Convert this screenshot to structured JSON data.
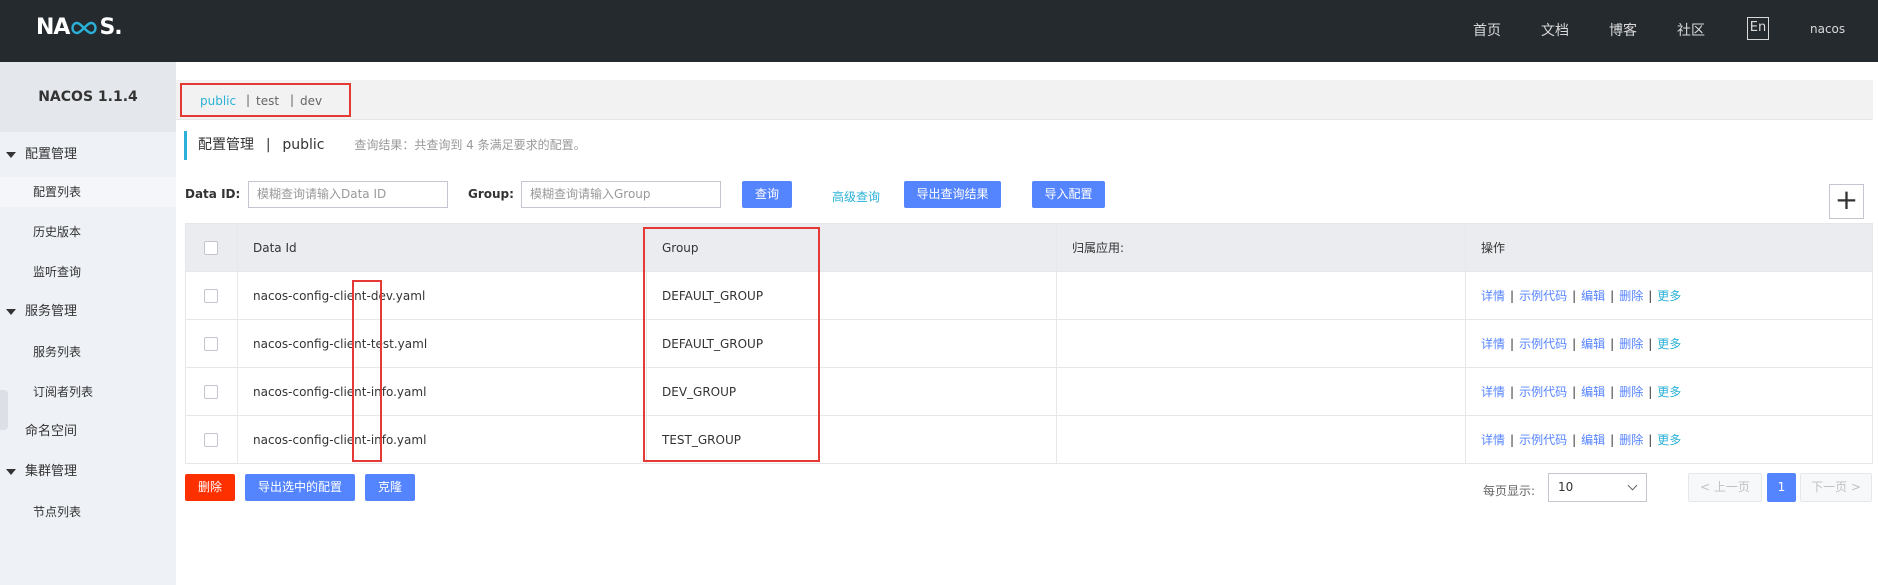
{
  "app": {
    "logo": "NACOS.",
    "version": "NACOS 1.1.4",
    "user": "nacos",
    "lang": "En"
  },
  "nav": [
    "首页",
    "文档",
    "博客",
    "社区"
  ],
  "sidebar": {
    "groups": [
      {
        "label": "配置管理",
        "items": [
          "配置列表",
          "历史版本",
          "监听查询"
        ]
      },
      {
        "label": "服务管理",
        "items": [
          "服务列表",
          "订阅者列表"
        ]
      },
      {
        "label": "命名空间"
      },
      {
        "label": "集群管理",
        "items": [
          "节点列表"
        ]
      }
    ]
  },
  "namespaces": [
    "public",
    "test",
    "dev"
  ],
  "page": {
    "title": "配置管理",
    "namespace": "public",
    "hint": "查询结果：共查询到 4 条满足要求的配置。"
  },
  "filters": {
    "data_id_label": "Data ID:",
    "data_id_placeholder": "模糊查询请输入Data ID",
    "group_label": "Group:",
    "group_placeholder": "模糊查询请输入Group",
    "query": "查询",
    "advanced": "高级查询",
    "export_results": "导出查询结果",
    "import": "导入配置"
  },
  "table": {
    "headers": [
      "Data Id",
      "Group",
      "归属应用:",
      "操作"
    ],
    "rows": [
      {
        "data_id": "nacos-config-client-dev.yaml",
        "group": "DEFAULT_GROUP",
        "app": ""
      },
      {
        "data_id": "nacos-config-client-test.yaml",
        "group": "DEFAULT_GROUP",
        "app": ""
      },
      {
        "data_id": "nacos-config-client-info.yaml",
        "group": "DEV_GROUP",
        "app": ""
      },
      {
        "data_id": "nacos-config-client-info.yaml",
        "group": "TEST_GROUP",
        "app": ""
      }
    ],
    "ops": [
      "详情",
      "示例代码",
      "编辑",
      "删除",
      "更多"
    ]
  },
  "actions": {
    "delete": "删除",
    "export_selected": "导出选中的配置",
    "clone": "克隆"
  },
  "pager": {
    "label": "每页显示:",
    "page_size": "10",
    "prev": "< 上一页",
    "current": "1",
    "next": "下一页 >"
  },
  "colors": {
    "topbar": "#252a2f",
    "primary": "#5584ff",
    "accent": "#2bb1d8",
    "danger": "#ff3000",
    "highlight_box": "#e53935"
  }
}
